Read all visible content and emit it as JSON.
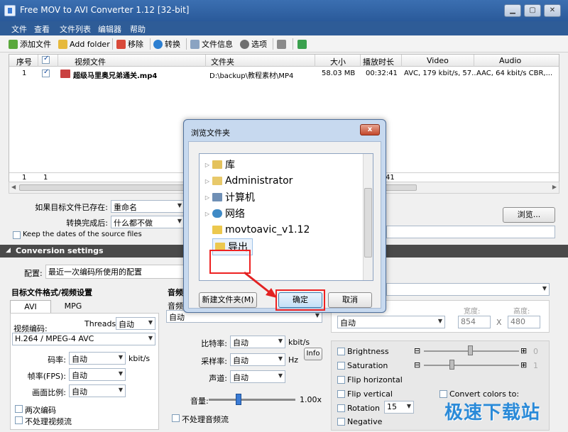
{
  "window": {
    "title": "Free MOV to AVI Converter 1.12  [32-bit]"
  },
  "menu": [
    "文件",
    "查看",
    "文件列表",
    "编辑器",
    "帮助"
  ],
  "toolbar": {
    "add_file": "添加文件",
    "add_folder": "Add folder",
    "remove": "移除",
    "convert": "转换",
    "file_info": "文件信息",
    "options": "选项"
  },
  "table": {
    "headers": [
      "序号",
      "",
      "视频文件",
      "文件夹",
      "大小",
      "播放时长",
      "Video",
      "Audio"
    ],
    "row": {
      "index": "1",
      "file": "超级马里奥兄弟通关.mp4",
      "folder": "D:\\backup\\教程素材\\MP4",
      "size": "58.03 MB",
      "duration": "00:32:41",
      "video": "AVC, 179 kbit/s, 57...",
      "audio": "AAC, 64 kbit/s CBR,..."
    },
    "footer": {
      "count": "1",
      "checked": "1",
      "partial": "41"
    }
  },
  "settings": {
    "if_exists_label": "如果目标文件已存在:",
    "if_exists_value": "重命名",
    "after_label": "转换完成后:",
    "after_value": "什么都不做",
    "browse": "浏览...",
    "keep_dates": "Keep the dates of the source files",
    "section": "Conversion settings",
    "profile_label": "配置:",
    "profile_value": "最近一次编码所使用的配置",
    "target_format_title": "目标文件格式/视频设置",
    "audio_title": "音频",
    "tab_avi": "AVI",
    "tab_mpg": "MPG",
    "threads_label": "Threads:",
    "threads_value": "自动",
    "video_codec_label": "视频编码:",
    "video_codec_value": "H.264 / MPEG-4 AVC",
    "bitrate_label": "码率:",
    "bitrate_value": "自动",
    "bitrate_unit": "kbit/s",
    "fps_label": "帧率(FPS):",
    "fps_value": "自动",
    "aspect_label": "画面比例:",
    "aspect_value": "自动",
    "two_pass": "两次编码",
    "no_video": "不处理视频流",
    "audio_codec_short": "音频",
    "audio_codec_value": "自动",
    "a_bitrate_label": "比特率:",
    "a_bitrate_value": "自动",
    "a_bitrate_unit": "kbit/s",
    "samplerate_label": "采样率:",
    "samplerate_value": "自动",
    "samplerate_unit": "Hz",
    "info": "Info",
    "channels_label": "声道:",
    "channels_value": "自动",
    "volume_label": "音量:",
    "volume_value": "1.00x",
    "no_audio": "不处理音频流",
    "size_mode_value": "自动",
    "width_label": "宽度:",
    "width_value": "854",
    "height_label": "高度:",
    "height_value": "480",
    "x_sep": "X",
    "brightness": "Brightness",
    "saturation": "Saturation",
    "brightness_value": "0",
    "saturation_value": "1",
    "flip_h": "Flip horizontal",
    "flip_v": "Flip vertical",
    "convert_colors": "Convert colors to:",
    "rotation": "Rotation",
    "rotation_value": "15",
    "negative": "Negative"
  },
  "dialog": {
    "title": "浏览文件夹",
    "close": "x",
    "nodes": [
      {
        "label": "库",
        "icon": "library-icon"
      },
      {
        "label": "Administrator",
        "icon": "user-folder-icon"
      },
      {
        "label": "计算机",
        "icon": "computer-icon"
      },
      {
        "label": "网络",
        "icon": "network-icon"
      },
      {
        "label": "movtoavic_v1.12",
        "icon": "folder-icon"
      },
      {
        "label": "导出",
        "icon": "folder-icon"
      }
    ],
    "new_folder": "新建文件夹(M)",
    "ok": "确定",
    "cancel": "取消"
  },
  "watermark": "极速下载站",
  "colors": {
    "accent": "#2e5c97",
    "annotation": "#e22222"
  }
}
